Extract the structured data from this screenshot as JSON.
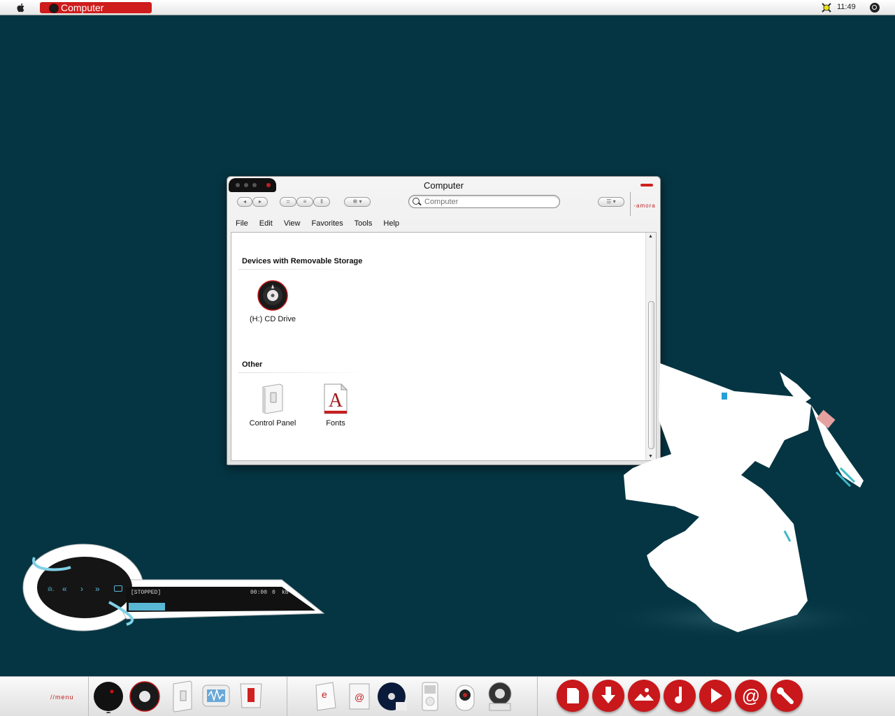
{
  "menubar": {
    "app_name": "Computer",
    "clock": "11:49"
  },
  "window": {
    "title": "Computer",
    "search_placeholder": "Computer",
    "brand_text": "-amora",
    "menu": [
      "File",
      "Edit",
      "View",
      "Favorites",
      "Tools",
      "Help"
    ],
    "sections": [
      {
        "title": "Devices with Removable Storage",
        "items": [
          {
            "label": "(H:) CD Drive",
            "icon": "cd-drive-icon"
          }
        ]
      },
      {
        "title": "Other",
        "items": [
          {
            "label": "Control Panel",
            "icon": "control-panel-icon"
          },
          {
            "label": "Fonts",
            "icon": "fonts-icon"
          }
        ]
      }
    ]
  },
  "player": {
    "status": "[STOPPED]",
    "time": "00:00",
    "bitrate": "0",
    "khz": "kb"
  },
  "dock": {
    "menu_label": "//menu",
    "icons": [
      "orb-icon",
      "cd-drive-icon",
      "control-panel-icon",
      "audio-wave-icon",
      "archive-icon",
      "browser-icon",
      "mail-icon",
      "dvd-icon",
      "ipod-icon",
      "webcam-icon",
      "system-icon"
    ],
    "circle_icons": [
      "document-icon",
      "download-icon",
      "photos-icon",
      "music-icon",
      "play-icon",
      "at-icon",
      "tools-icon"
    ]
  },
  "colors": {
    "desktop": "#053543",
    "accent": "#cf1c1c"
  }
}
